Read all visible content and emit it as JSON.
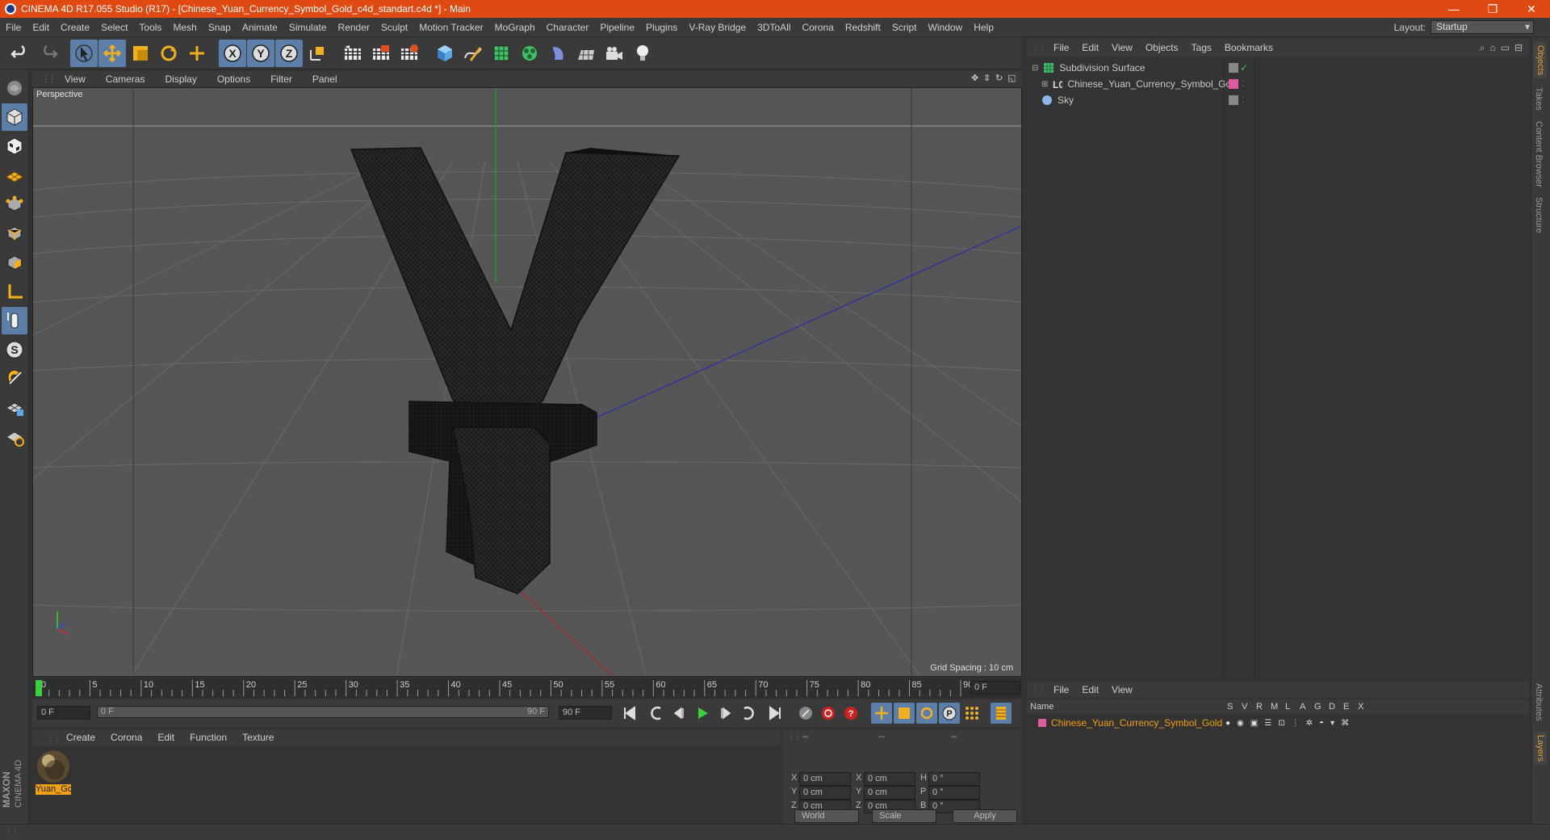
{
  "window": {
    "title": "CINEMA 4D R17.055 Studio (R17) - [Chinese_Yuan_Currency_Symbol_Gold_c4d_standart.c4d *] - Main",
    "controls": [
      "minimize",
      "restore",
      "close"
    ]
  },
  "menubar": {
    "items": [
      "File",
      "Edit",
      "Create",
      "Select",
      "Tools",
      "Mesh",
      "Snap",
      "Animate",
      "Simulate",
      "Render",
      "Sculpt",
      "Motion Tracker",
      "MoGraph",
      "Character",
      "Pipeline",
      "Plugins",
      "V-Ray Bridge",
      "3DToAll",
      "Corona",
      "Redshift",
      "Script",
      "Window",
      "Help"
    ],
    "layout_label": "Layout:",
    "layout_value": "Startup"
  },
  "toolbar": {
    "icons": [
      "undo-icon",
      "redo-icon",
      "select-arrow-icon",
      "move-icon",
      "scale-icon",
      "rotate-icon",
      "add-object-icon",
      "x-axis-icon",
      "y-axis-icon",
      "z-axis-icon",
      "world-coord-icon",
      "render-view-icon",
      "render-picture-viewer-icon",
      "edit-render-settings-icon",
      "cube-icon",
      "pen-spline-icon",
      "subdivision-icon",
      "cloner-icon",
      "deformer-icon",
      "floor-scene-icon",
      "camera-icon",
      "light-icon"
    ],
    "axis_letters": [
      "X",
      "Y",
      "Z"
    ]
  },
  "left_toolbar": {
    "icons": [
      "make-editable-icon",
      "model-mode-icon",
      "texture-mode-icon",
      "workplane-icon",
      "points-mode-icon",
      "edges-mode-icon",
      "polygons-mode-icon",
      "axis-mode-icon",
      "tweak-mode-icon",
      "snap-s-icon",
      "magnet-icon",
      "grid-lock-icon",
      "solo-icon"
    ],
    "snap_letter": "S"
  },
  "brand": {
    "line1": "MAXON",
    "line2": "CINEMA 4D"
  },
  "viewport": {
    "menu": [
      "View",
      "Cameras",
      "Display",
      "Options",
      "Filter",
      "Panel"
    ],
    "label": "Perspective",
    "grid_spacing": "Grid Spacing : 10 cm",
    "object_glyph": "¥"
  },
  "timeline": {
    "ticks": [
      "0",
      "5",
      "10",
      "15",
      "20",
      "25",
      "30",
      "35",
      "40",
      "45",
      "50",
      "55",
      "60",
      "65",
      "70",
      "75",
      "80",
      "85",
      "90"
    ],
    "current_frame": "0 F",
    "start_frame": "0 F",
    "slider_left": "0 F",
    "slider_right": "90 F",
    "end_frame": "90 F"
  },
  "playback": {
    "icons": [
      "go-to-start-icon",
      "prev-key-icon",
      "prev-frame-icon",
      "play-icon",
      "next-frame-icon",
      "next-key-icon",
      "go-to-end-icon",
      "keyframe-select-icon",
      "record-icon",
      "autokey-icon",
      "key-move-icon",
      "key-scale-icon",
      "key-rotate-icon",
      "key-param-icon",
      "key-pla-icon",
      "timeline-icon"
    ],
    "param_letter": "P"
  },
  "materials": {
    "menu": [
      "Create",
      "Corona",
      "Edit",
      "Function",
      "Texture"
    ],
    "items": [
      {
        "name": "Yuan_Gc"
      }
    ]
  },
  "coordinates": {
    "headers": [
      "--",
      "--",
      "--"
    ],
    "rows": [
      {
        "a": "X",
        "av": "0 cm",
        "b": "X",
        "bv": "0 cm",
        "c": "H",
        "cv": "0 °"
      },
      {
        "a": "Y",
        "av": "0 cm",
        "b": "Y",
        "bv": "0 cm",
        "c": "P",
        "cv": "0 °"
      },
      {
        "a": "Z",
        "av": "0 cm",
        "b": "Z",
        "bv": "0 cm",
        "c": "B",
        "cv": "0 °"
      }
    ],
    "mode": "World",
    "size_mode": "Scale",
    "apply": "Apply"
  },
  "object_manager": {
    "menu": [
      "File",
      "Edit",
      "View",
      "Objects",
      "Tags",
      "Bookmarks"
    ],
    "objects": [
      {
        "name": "Subdivision Surface",
        "icon": "subdivision-icon"
      },
      {
        "name": "Chinese_Yuan_Currency_Symbol_Gold",
        "icon": "null-object-icon"
      },
      {
        "name": "Sky",
        "icon": "sky-icon"
      }
    ],
    "colors": {
      "selected": "#c9c9c9",
      "tag_pink": "#e05aa0",
      "check_green": "#3bd13b"
    }
  },
  "layer_manager": {
    "menu": [
      "File",
      "Edit",
      "View"
    ],
    "columns": [
      "Name",
      "S",
      "V",
      "R",
      "M",
      "L",
      "A",
      "G",
      "D",
      "E",
      "X"
    ],
    "layers": [
      {
        "name": "Chinese_Yuan_Currency_Symbol_Gold",
        "color": "#e05aa0"
      }
    ],
    "name_color": "#f0a010"
  },
  "right_tabs": [
    "Objects",
    "Takes",
    "Content Browser",
    "Structure",
    "Attributes",
    "Layers"
  ]
}
